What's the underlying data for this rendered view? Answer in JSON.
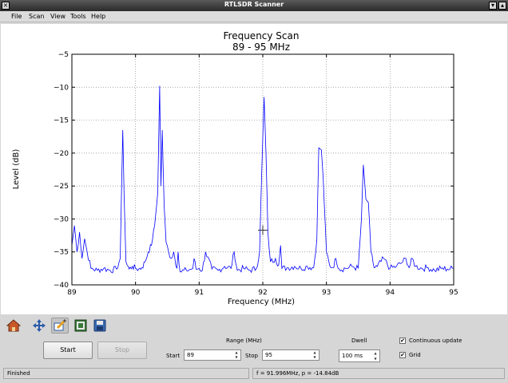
{
  "window": {
    "title": "RTLSDR Scanner"
  },
  "menu": {
    "items": [
      "File",
      "Scan",
      "View",
      "Tools",
      "Help"
    ]
  },
  "chart_data": {
    "type": "line",
    "title": "Frequency Scan",
    "subtitle": "89 - 95 MHz",
    "xlabel": "Frequency (MHz)",
    "ylabel": "Level (dB)",
    "xlim": [
      89,
      95
    ],
    "ylim": [
      -40,
      -5
    ],
    "xticks": [
      "89",
      "90",
      "91",
      "92",
      "93",
      "94",
      "95"
    ],
    "yticks": [
      "−5",
      "−10",
      "−15",
      "−20",
      "−25",
      "−30",
      "−35",
      "−40"
    ],
    "grid": true,
    "line_color": "#0000ff",
    "cursor": {
      "x": 92.0,
      "y": -31.7
    },
    "series": [
      {
        "x": [
          89.0,
          89.04,
          89.08,
          89.12,
          89.16,
          89.2,
          89.24,
          89.3,
          89.4,
          89.5,
          89.6,
          89.7,
          89.76,
          89.8,
          89.82,
          89.85,
          89.9,
          89.95,
          90.0,
          90.05,
          90.1,
          90.15,
          90.2,
          90.25,
          90.3,
          90.35,
          90.38,
          90.4,
          90.42,
          90.45,
          90.48,
          90.52,
          90.56,
          90.6,
          90.65,
          90.67,
          90.7,
          90.8,
          90.9,
          90.92,
          90.95,
          91.0,
          91.05,
          91.1,
          91.2,
          91.3,
          91.4,
          91.5,
          91.55,
          91.6,
          91.7,
          91.8,
          91.9,
          91.95,
          91.98,
          92.02,
          92.05,
          92.08,
          92.12,
          92.2,
          92.25,
          92.28,
          92.3,
          92.4,
          92.5,
          92.6,
          92.7,
          92.8,
          92.85,
          92.88,
          92.92,
          92.95,
          93.0,
          93.05,
          93.1,
          93.15,
          93.2,
          93.3,
          93.4,
          93.5,
          93.55,
          93.58,
          93.62,
          93.66,
          93.7,
          93.75,
          93.8,
          93.9,
          94.0,
          94.1,
          94.2,
          94.25,
          94.3,
          94.35,
          94.4,
          94.5,
          94.6,
          94.7,
          94.8,
          94.9,
          95.0
        ],
        "values": [
          -34,
          -31,
          -35,
          -32,
          -36,
          -33,
          -35,
          -37.5,
          -37.8,
          -37.5,
          -37.8,
          -37.6,
          -36,
          -16.5,
          -26,
          -36.5,
          -37.6,
          -37.2,
          -37.5,
          -37.6,
          -37.4,
          -36.5,
          -35,
          -34,
          -31,
          -26,
          -9.8,
          -25,
          -16.5,
          -28,
          -33.5,
          -35,
          -36,
          -35,
          -37.5,
          -35,
          -38,
          -37.8,
          -37.5,
          -36,
          -37.6,
          -37.5,
          -37.8,
          -35,
          -37.6,
          -37.8,
          -37.2,
          -37.5,
          -35,
          -37.8,
          -37.5,
          -37.8,
          -37.5,
          -35,
          -24,
          -11.5,
          -20,
          -32,
          -36.5,
          -36,
          -37,
          -34,
          -37.5,
          -37.4,
          -37.2,
          -37.5,
          -37.2,
          -37.4,
          -33,
          -19.2,
          -19.5,
          -24,
          -35,
          -37,
          -37.4,
          -36,
          -37.6,
          -37.5,
          -37.2,
          -37.5,
          -30,
          -21.8,
          -27,
          -27.5,
          -35,
          -37.4,
          -37.2,
          -36,
          -37.5,
          -37.2,
          -36.5,
          -36,
          -37.4,
          -36,
          -37.2,
          -37.5,
          -37.4,
          -37.8,
          -37.5,
          -37.6,
          -37.5
        ]
      }
    ]
  },
  "toolbar": {
    "tools": [
      {
        "name": "home-icon",
        "active": false
      },
      {
        "name": "pan-icon",
        "active": false
      },
      {
        "name": "zoom-icon",
        "active": true
      },
      {
        "name": "configure-icon",
        "active": false
      },
      {
        "name": "save-icon",
        "active": false
      }
    ]
  },
  "controls": {
    "start_label": "Start",
    "stop_label": "Stop",
    "range_label": "Range (MHz)",
    "start_field_label": "Start",
    "start_value": "89",
    "stop_field_label": "Stop",
    "stop_value": "95",
    "dwell_label": "Dwell",
    "dwell_value": "100 ms",
    "continuous_label": "Continuous update",
    "continuous_checked": true,
    "grid_label": "Grid",
    "grid_checked": true
  },
  "status": {
    "left": "Finished",
    "right": "f = 91.996MHz, p = -14.84dB"
  }
}
